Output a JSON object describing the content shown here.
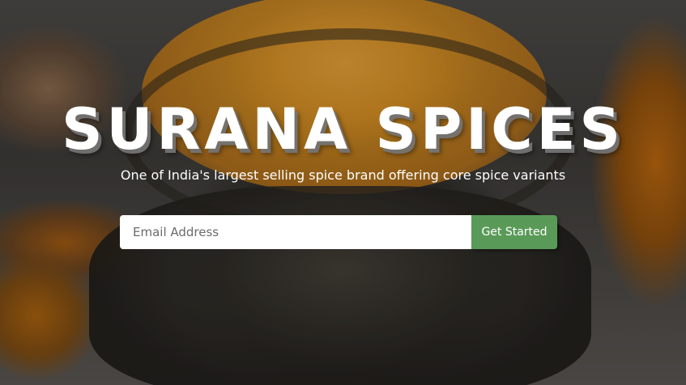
{
  "hero": {
    "title": "SURANA SPICES",
    "subtitle": "One of India's largest selling spice brand offering core spice variants"
  },
  "signup": {
    "email_placeholder": "Email Address",
    "email_value": "",
    "button_label": "Get Started"
  },
  "colors": {
    "button": "#5a9a58",
    "title": "#ffffff",
    "title_shadow": "#787878",
    "turmeric": "#d18a1e"
  }
}
